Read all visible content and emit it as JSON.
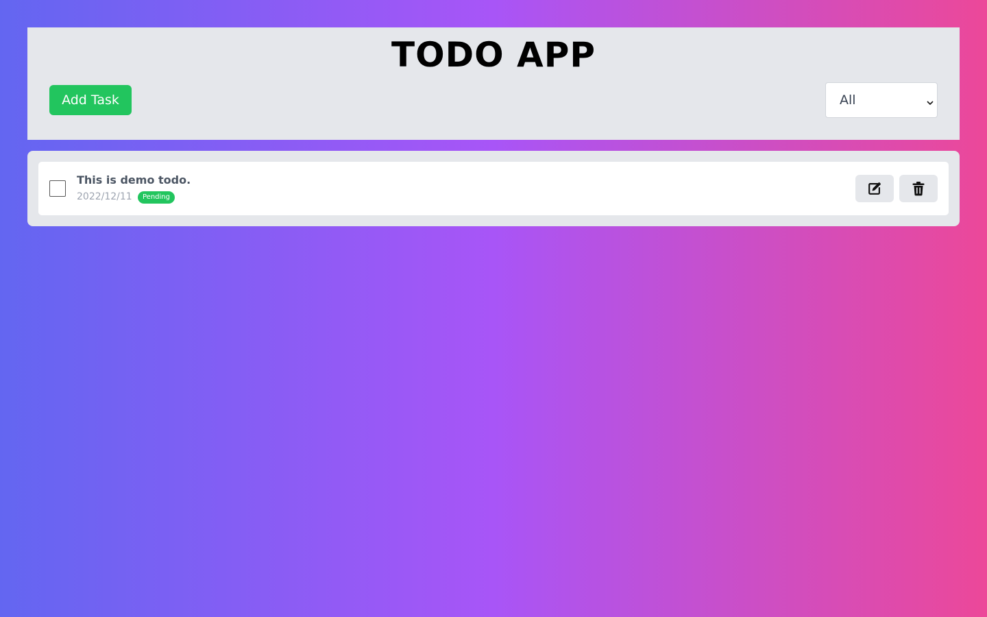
{
  "app": {
    "title": "TODO APP"
  },
  "toolbar": {
    "add_task_label": "Add Task",
    "filter": {
      "selected": "All"
    }
  },
  "todos": [
    {
      "title": "This is demo todo.",
      "date": "2022/12/11",
      "status": "Pending",
      "completed": false,
      "actions": {
        "edit_icon": "edit-icon",
        "delete_icon": "trash-icon"
      }
    }
  ],
  "colors": {
    "gradient_start": "#6366f1",
    "gradient_mid": "#a855f7",
    "gradient_end": "#ec4899",
    "accent_green": "#22c55e",
    "panel_gray": "#e5e7eb"
  }
}
